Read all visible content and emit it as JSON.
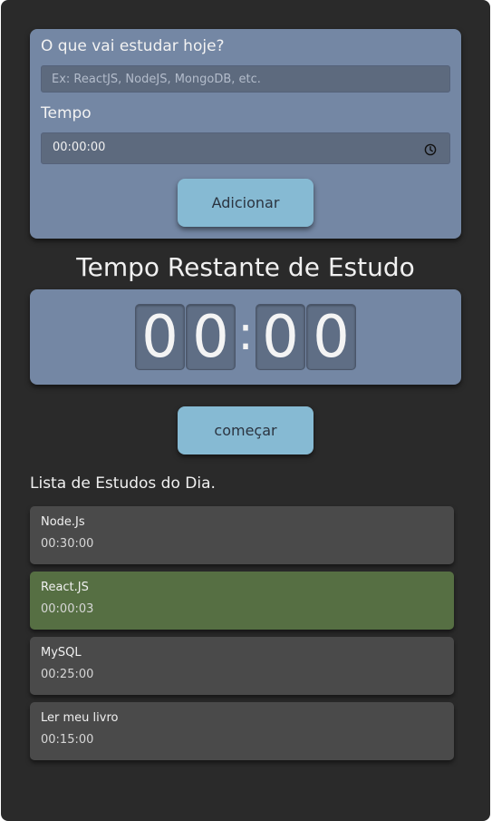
{
  "form": {
    "subject_label": "O que vai estudar hoje?",
    "subject_placeholder": "Ex: ReactJS, NodeJS, MongoDB, etc.",
    "subject_value": "",
    "time_label": "Tempo",
    "time_value": "00:00:00",
    "add_button": "Adicionar"
  },
  "timer": {
    "title": "Tempo Restante de Estudo",
    "digits": [
      "0",
      "0",
      "0",
      "0"
    ],
    "separator": ":"
  },
  "start_button": "começar",
  "list": {
    "title": "Lista de Estudos do Dia.",
    "items": [
      {
        "name": "Node.Js",
        "time": "00:30:00",
        "selected": false
      },
      {
        "name": "React.JS",
        "time": "00:00:03",
        "selected": true
      },
      {
        "name": "MySQL",
        "time": "00:25:00",
        "selected": false
      },
      {
        "name": "Ler meu livro",
        "time": "00:15:00",
        "selected": false
      }
    ]
  },
  "icons": {
    "time_input": "clock-icon"
  },
  "colors": {
    "background": "#2a2a2a",
    "card": "#7487a4",
    "button": "#86bad3",
    "item": "#4a4a4a",
    "item_selected": "#566f43"
  }
}
